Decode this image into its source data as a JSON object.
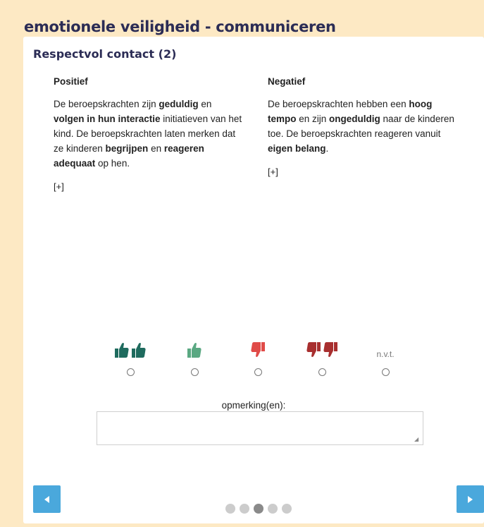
{
  "header": {
    "title": "emotionele veiligheid - communiceren"
  },
  "card": {
    "title": "Respectvol contact (2)",
    "positive": {
      "heading": "Positief",
      "segments": [
        {
          "t": "De beroepskrachten zijn ",
          "b": false
        },
        {
          "t": "geduldig",
          "b": true
        },
        {
          "t": " en ",
          "b": false
        },
        {
          "t": "volgen in hun interactie",
          "b": true
        },
        {
          "t": " initiatieven van het kind. De beroepskrachten laten merken dat ze kinderen ",
          "b": false
        },
        {
          "t": "begrijpen",
          "b": true
        },
        {
          "t": " en ",
          "b": false
        },
        {
          "t": "reageren adequaat",
          "b": true
        },
        {
          "t": " op hen.",
          "b": false
        }
      ],
      "more": "[+]"
    },
    "negative": {
      "heading": "Negatief",
      "segments": [
        {
          "t": "De beroepskrachten hebben een ",
          "b": false
        },
        {
          "t": "hoog tempo",
          "b": true
        },
        {
          "t": " en zijn ",
          "b": false
        },
        {
          "t": "ongeduldig",
          "b": true
        },
        {
          "t": " naar de kinderen toe. De beroepskrachten reageren vanuit ",
          "b": false
        },
        {
          "t": "eigen belang",
          "b": true
        },
        {
          "t": ".",
          "b": false
        }
      ],
      "more": "[+]"
    }
  },
  "ratings": [
    {
      "id": "very-positive",
      "icons": [
        "thumb-up-icon",
        "thumb-up-icon"
      ],
      "color": "#1f6b5e"
    },
    {
      "id": "positive",
      "icons": [
        "thumb-up-icon"
      ],
      "color": "#5aa882"
    },
    {
      "id": "negative",
      "icons": [
        "thumb-down-icon"
      ],
      "color": "#e04b48"
    },
    {
      "id": "very-negative",
      "icons": [
        "thumb-down-icon",
        "thumb-down-icon"
      ],
      "color": "#a82f2f"
    },
    {
      "id": "nvt",
      "label": "n.v.t."
    }
  ],
  "comment": {
    "label": "opmerking(en):",
    "value": ""
  },
  "pagination": {
    "total": 5,
    "active": 3
  },
  "colors": {
    "background": "#fde9c4",
    "nav": "#4aa8dc",
    "title": "#2b2c55"
  }
}
